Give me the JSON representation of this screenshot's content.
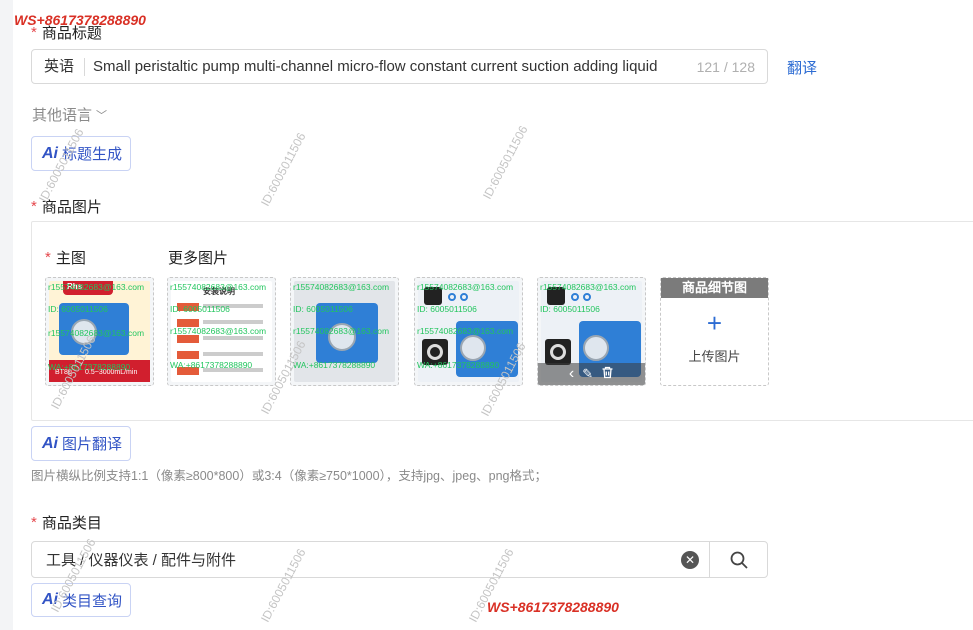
{
  "watermarks": {
    "contact": "WS+8617378288890",
    "id": "ID:6005011506",
    "email": "r15574082683@163.com",
    "id_short": "ID: 6005011506",
    "wa": "WA:+8617378288890"
  },
  "title_section": {
    "label": "商品标题",
    "lang": "英语",
    "value": "Small peristaltic pump multi-channel micro-flow constant current suction adding liquid",
    "count": "121 / 128",
    "translate_link": "翻译",
    "other_lang": "其他语言",
    "ai_button": "标题生成"
  },
  "image_section": {
    "label": "商品图片",
    "main_label": "主图",
    "more_label": "更多图片",
    "thumb_text": {
      "rhs": "Rhs",
      "bt": "BT80",
      "specs": "0.5~3000mL/min",
      "doc_title": "安装说明"
    },
    "upload_header": "商品细节图",
    "upload_plus": "+",
    "upload_text": "上传图片",
    "ai_button": "图片翻译",
    "hint": "图片横纵比例支持1:1（像素≥800*800）或3:4（像素≥750*1000），支持jpg、jpeg、png格式；"
  },
  "category_section": {
    "label": "商品类目",
    "value": "工具 / 仪器仪表 / 配件与附件",
    "ai_button": "类目查询"
  },
  "icons": {
    "ai": "Ai",
    "chevron": "﹀",
    "clear": "✕",
    "arrow_left": "‹",
    "edit": "✎",
    "trash": "🗑"
  },
  "colors": {
    "accent": "#2d6cd3",
    "required": "#e5484d",
    "pump_blue": "#2f7fd6",
    "watermark_red": "#d93025",
    "watermark_green": "#22c55e"
  }
}
